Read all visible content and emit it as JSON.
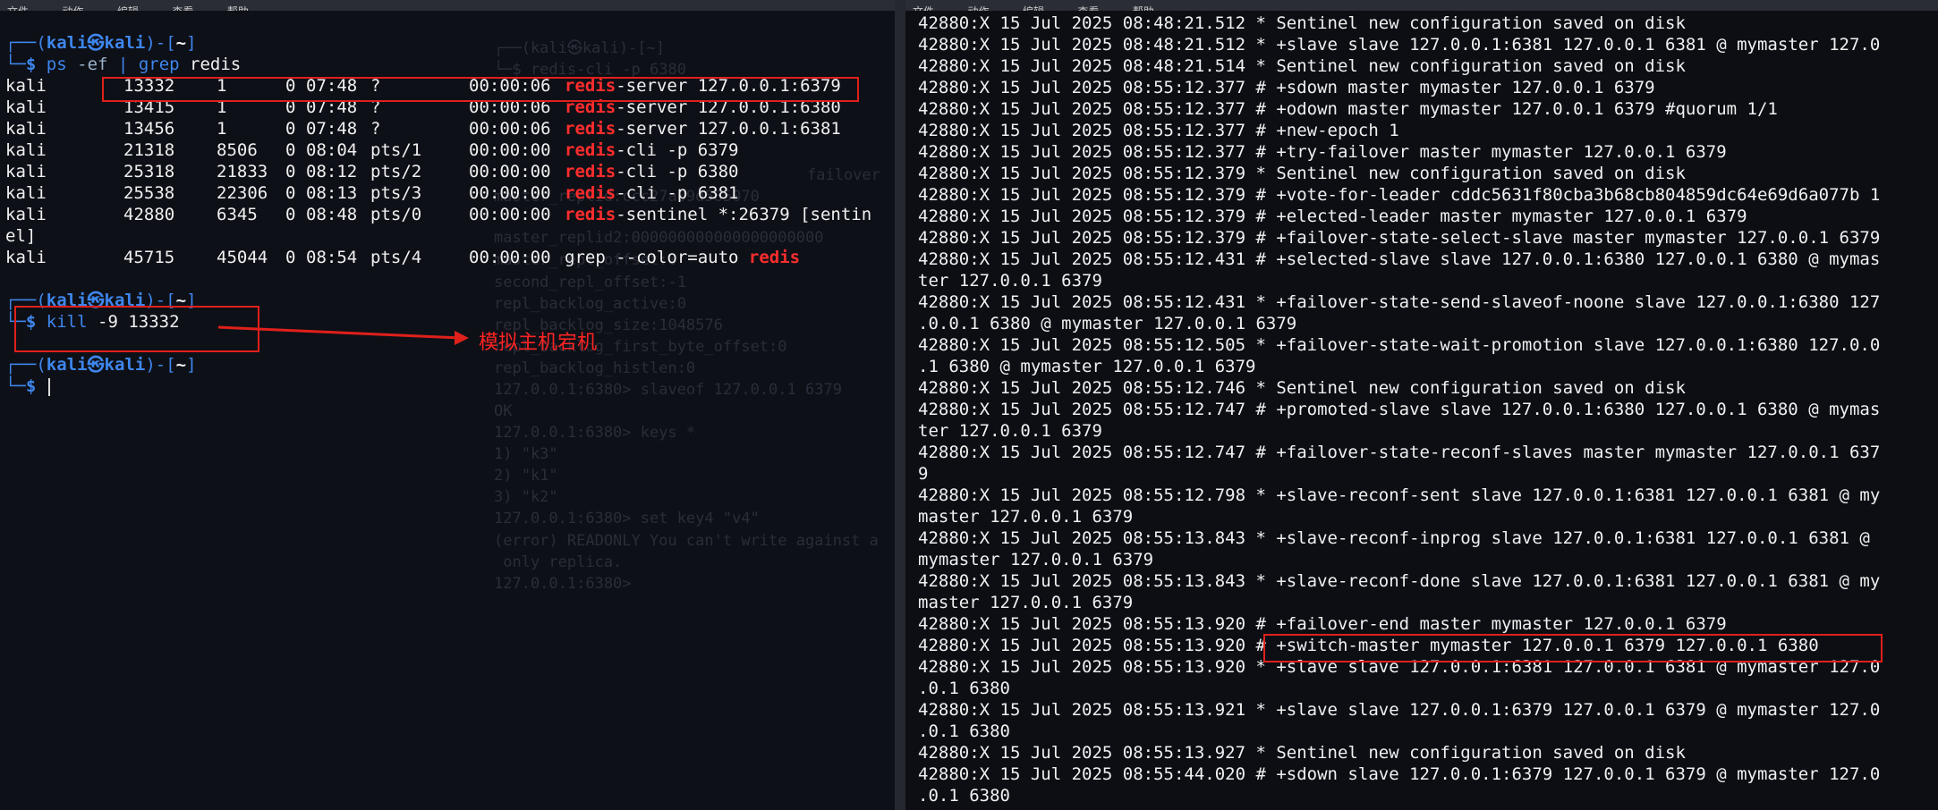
{
  "left_terminal": {
    "menu": [
      "文件",
      "动作",
      "编辑",
      "查看",
      "帮助"
    ],
    "prompt": {
      "user": "kali",
      "at": "㉿",
      "host": "kali",
      "dir": "~",
      "symbol": "$"
    },
    "cmd1": {
      "name": "ps",
      "args": "-ef",
      "pipe": "|",
      "grep": "grep",
      "pattern": "redis"
    },
    "ps_rows": [
      {
        "user": "kali",
        "pid": "13332",
        "ppid": "1",
        "c": "0",
        "stime": "07:48",
        "tty": "?",
        "time": "00:00:06",
        "match": "redis",
        "rest": "-server 127.0.0.1:6379",
        "tail": ""
      },
      {
        "user": "kali",
        "pid": "13415",
        "ppid": "1",
        "c": "0",
        "stime": "07:48",
        "tty": "?",
        "time": "00:00:06",
        "match": "redis",
        "rest": "-server 127.0.0.1:6380",
        "tail": ""
      },
      {
        "user": "kali",
        "pid": "13456",
        "ppid": "1",
        "c": "0",
        "stime": "07:48",
        "tty": "?",
        "time": "00:00:06",
        "match": "redis",
        "rest": "-server 127.0.0.1:6381",
        "tail": ""
      },
      {
        "user": "kali",
        "pid": "21318",
        "ppid": "8506",
        "c": "0",
        "stime": "08:04",
        "tty": "pts/1",
        "time": "00:00:00",
        "match": "redis",
        "rest": "-cli -p 6379",
        "tail": ""
      },
      {
        "user": "kali",
        "pid": "25318",
        "ppid": "21833",
        "c": "0",
        "stime": "08:12",
        "tty": "pts/2",
        "time": "00:00:00",
        "match": "redis",
        "rest": "-cli -p 6380",
        "tail": ""
      },
      {
        "user": "kali",
        "pid": "25538",
        "ppid": "22306",
        "c": "0",
        "stime": "08:13",
        "tty": "pts/3",
        "time": "00:00:00",
        "match": "redis",
        "rest": "-cli -p 6381",
        "tail": ""
      },
      {
        "user": "kali",
        "pid": "42880",
        "ppid": "6345",
        "c": "0",
        "stime": "08:48",
        "tty": "pts/0",
        "time": "00:00:00",
        "match": "redis",
        "rest": "-sentinel *:26379 [sentin",
        "tail": "el]"
      }
    ],
    "grep_row": {
      "user": "kali",
      "pid": "45715",
      "ppid": "45044",
      "c": "0",
      "stime": "08:54",
      "tty": "pts/4",
      "time": "00:00:00",
      "pre": "grep --color=auto ",
      "match": "redis"
    },
    "cmd2": {
      "name": "kill",
      "args": "-9 13332"
    },
    "annotation": "模拟主机宕机",
    "background_text": [
      "┌──(kali㉿kali)-[~]",
      "└─$ redis-cli -p 6380",
      "failover",
      "master_replid:ccc27a09d585070",
      "master_replid2:000000000000000000000",
      "master_repl_offset:0",
      "second_repl_offset:-1",
      "repl_backlog_active:0",
      "repl_backlog_size:1048576",
      "repl_backlog_first_byte_offset:0",
      "repl_backlog_histlen:0",
      "127.0.0.1:6380> slaveof 127.0.0.1 6379",
      "OK",
      "127.0.0.1:6380> keys *",
      "1) \"k3\"",
      "2) \"k1\"",
      "3) \"k2\"",
      "127.0.0.1:6380> set key4 \"v4\"",
      "(error) READONLY You can't write against a",
      " only replica.",
      "127.0.0.1:6380> "
    ]
  },
  "right_terminal": {
    "menu": [
      "文件",
      "动作",
      "编辑",
      "查看",
      "帮助"
    ],
    "log_lines": [
      "42880:X 15 Jul 2025 08:48:21.512 * Sentinel new configuration saved on disk",
      "42880:X 15 Jul 2025 08:48:21.512 * +slave slave 127.0.0.1:6381 127.0.0.1 6381 @ mymaster 127.0",
      "42880:X 15 Jul 2025 08:48:21.514 * Sentinel new configuration saved on disk",
      "42880:X 15 Jul 2025 08:55:12.377 # +sdown master mymaster 127.0.0.1 6379",
      "42880:X 15 Jul 2025 08:55:12.377 # +odown master mymaster 127.0.0.1 6379 #quorum 1/1",
      "42880:X 15 Jul 2025 08:55:12.377 # +new-epoch 1",
      "42880:X 15 Jul 2025 08:55:12.377 # +try-failover master mymaster 127.0.0.1 6379",
      "42880:X 15 Jul 2025 08:55:12.379 * Sentinel new configuration saved on disk",
      "42880:X 15 Jul 2025 08:55:12.379 # +vote-for-leader cddc5631f80cba3b68cb804859dc64e69d6a077b 1",
      "42880:X 15 Jul 2025 08:55:12.379 # +elected-leader master mymaster 127.0.0.1 6379",
      "42880:X 15 Jul 2025 08:55:12.379 # +failover-state-select-slave master mymaster 127.0.0.1 6379",
      "42880:X 15 Jul 2025 08:55:12.431 # +selected-slave slave 127.0.0.1:6380 127.0.0.1 6380 @ mymas",
      "ter 127.0.0.1 6379",
      "42880:X 15 Jul 2025 08:55:12.431 * +failover-state-send-slaveof-noone slave 127.0.0.1:6380 127",
      ".0.0.1 6380 @ mymaster 127.0.0.1 6379",
      "42880:X 15 Jul 2025 08:55:12.505 * +failover-state-wait-promotion slave 127.0.0.1:6380 127.0.0",
      ".1 6380 @ mymaster 127.0.0.1 6379",
      "42880:X 15 Jul 2025 08:55:12.746 * Sentinel new configuration saved on disk",
      "42880:X 15 Jul 2025 08:55:12.747 # +promoted-slave slave 127.0.0.1:6380 127.0.0.1 6380 @ mymas",
      "ter 127.0.0.1 6379",
      "42880:X 15 Jul 2025 08:55:12.747 # +failover-state-reconf-slaves master mymaster 127.0.0.1 637",
      "9",
      "42880:X 15 Jul 2025 08:55:12.798 * +slave-reconf-sent slave 127.0.0.1:6381 127.0.0.1 6381 @ my",
      "master 127.0.0.1 6379",
      "42880:X 15 Jul 2025 08:55:13.843 * +slave-reconf-inprog slave 127.0.0.1:6381 127.0.0.1 6381 @",
      "mymaster 127.0.0.1 6379",
      "42880:X 15 Jul 2025 08:55:13.843 * +slave-reconf-done slave 127.0.0.1:6381 127.0.0.1 6381 @ my",
      "master 127.0.0.1 6379",
      "42880:X 15 Jul 2025 08:55:13.920 # +failover-end master mymaster 127.0.0.1 6379",
      "42880:X 15 Jul 2025 08:55:13.920 # +switch-master mymaster 127.0.0.1 6379 127.0.0.1 6380",
      "42880:X 15 Jul 2025 08:55:13.920 * +slave slave 127.0.0.1:6381 127.0.0.1 6381 @ mymaster 127.0",
      ".0.1 6380",
      "42880:X 15 Jul 2025 08:55:13.921 * +slave slave 127.0.0.1:6379 127.0.0.1 6379 @ mymaster 127.0",
      ".0.1 6380",
      "42880:X 15 Jul 2025 08:55:13.927 * Sentinel new configuration saved on disk",
      "42880:X 15 Jul 2025 08:55:44.020 # +sdown slave 127.0.0.1:6379 127.0.0.1 6379 @ mymaster 127.0",
      ".0.1 6380"
    ]
  },
  "colors": {
    "prompt_blue": "#3e86ec",
    "match_red": "#ff2d2d",
    "annotation_red": "#e0201b",
    "background": "#0e1017"
  }
}
